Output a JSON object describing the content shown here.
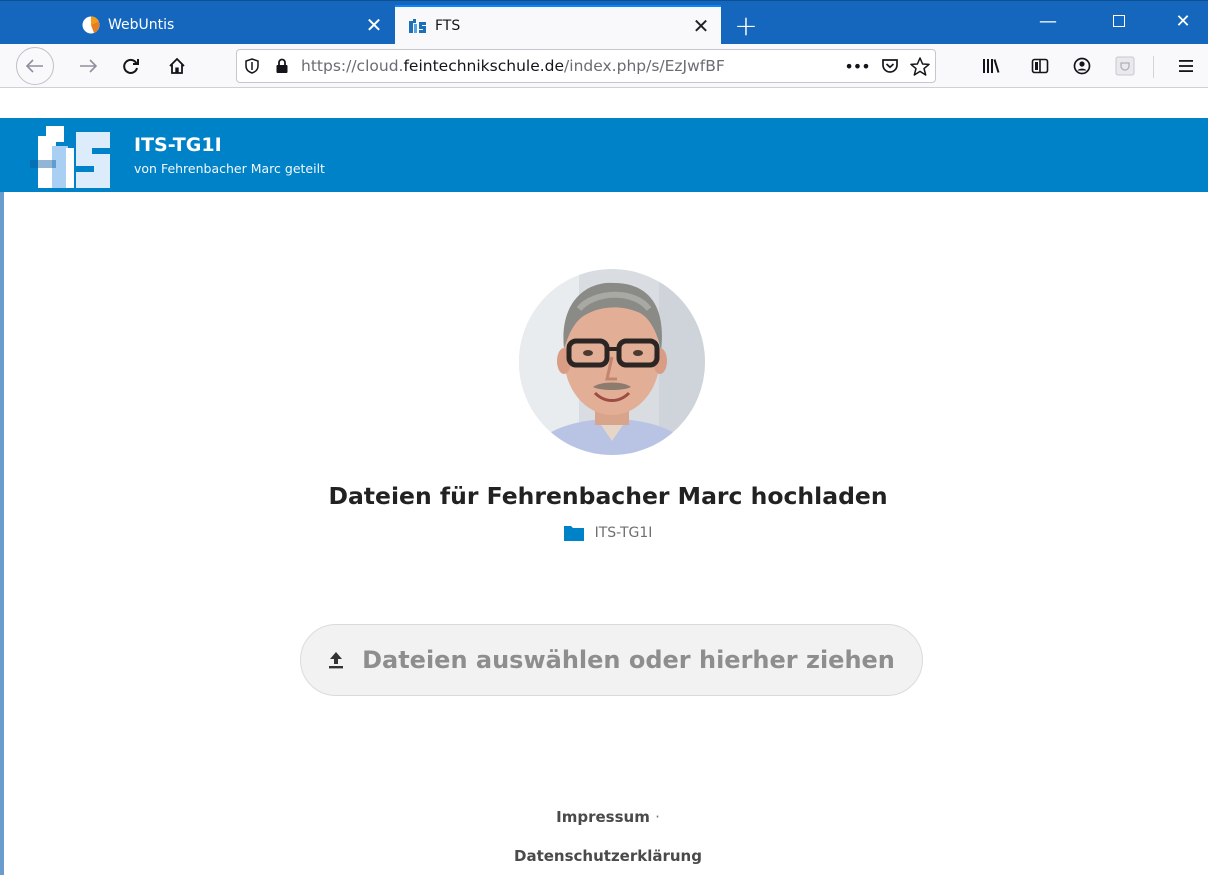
{
  "browser": {
    "tabs": [
      {
        "title": "WebUntis",
        "icon": "webuntis-clock-icon"
      },
      {
        "title": "FTS",
        "icon": "fts-logo-icon",
        "active": true
      }
    ],
    "new_tab_icon": "plus-icon",
    "url_parts": {
      "protocol": "https://cloud.",
      "host": "feintechnikschule.de",
      "path": "/index.php/s/EzJwfBF"
    },
    "more_label": "•••"
  },
  "header": {
    "title": "ITS-TG1I",
    "subtitle": "von Fehrenbacher Marc geteilt",
    "color": "#0082c9"
  },
  "main": {
    "heading": "Dateien für Fehrenbacher Marc hochladen",
    "folder_name": "ITS-TG1I",
    "upload_label": "Dateien auswählen oder hierher ziehen"
  },
  "footer": {
    "impressum": "Impressum",
    "separator": "·",
    "privacy": "Datenschutzerklärung"
  }
}
